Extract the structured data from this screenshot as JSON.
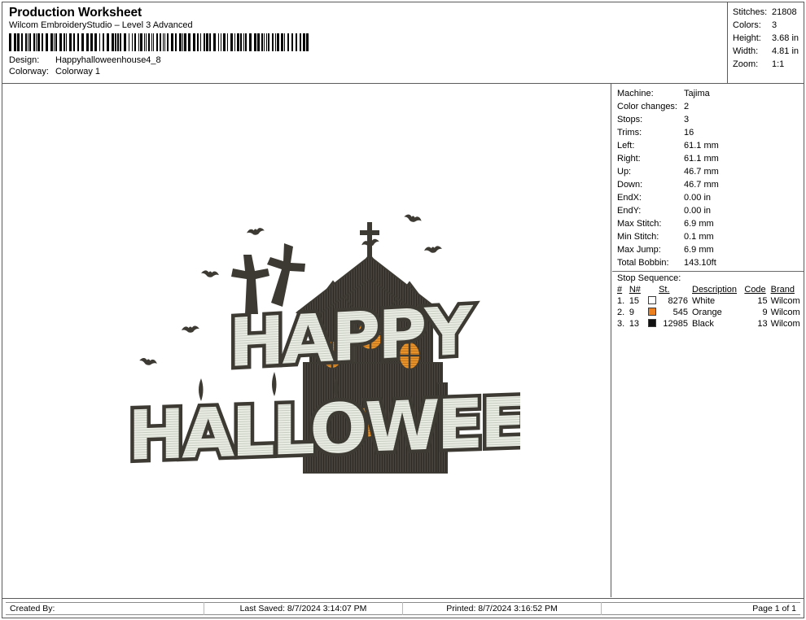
{
  "header": {
    "doc_title": "Production Worksheet",
    "app_name": "Wilcom EmbroideryStudio – Level 3 Advanced",
    "barcode_icon": "barcode",
    "design_label": "Design:",
    "design_value": "Happyhalloweenhouse4_8",
    "colorway_label": "Colorway:",
    "colorway_value": "Colorway 1"
  },
  "summary": [
    {
      "label": "Stitches:",
      "value": "21808"
    },
    {
      "label": "Colors:",
      "value": "3"
    },
    {
      "label": "Height:",
      "value": "3.68 in"
    },
    {
      "label": "Width:",
      "value": "4.81 in"
    },
    {
      "label": "Zoom:",
      "value": "1:1"
    }
  ],
  "info": [
    {
      "label": "Machine:",
      "value": "Tajima"
    },
    {
      "label": "Color changes:",
      "value": "2"
    },
    {
      "label": "Stops:",
      "value": "3"
    },
    {
      "label": "Trims:",
      "value": "16"
    },
    {
      "label": "Left:",
      "value": "61.1 mm"
    },
    {
      "label": "Right:",
      "value": "61.1 mm"
    },
    {
      "label": "Up:",
      "value": "46.7 mm"
    },
    {
      "label": "Down:",
      "value": "46.7 mm"
    },
    {
      "label": "EndX:",
      "value": "0.00 in"
    },
    {
      "label": "EndY:",
      "value": "0.00 in"
    },
    {
      "label": "Max Stitch:",
      "value": "6.9 mm"
    },
    {
      "label": "Min Stitch:",
      "value": "0.1 mm"
    },
    {
      "label": "Max Jump:",
      "value": "6.9 mm"
    },
    {
      "label": "Total Bobbin:",
      "value": "143.10ft"
    }
  ],
  "stop_sequence": {
    "title": "Stop Sequence:",
    "columns": [
      "#",
      "N#",
      "",
      "St.",
      "Description",
      "Code",
      "Brand"
    ],
    "rows": [
      {
        "num": "1.",
        "needle": "15",
        "color": "#ffffff",
        "stitches": "8276",
        "description": "White",
        "code": "15",
        "brand": "Wilcom"
      },
      {
        "num": "2.",
        "needle": "9",
        "color": "#ec7f1e",
        "stitches": "545",
        "description": "Orange",
        "code": "9",
        "brand": "Wilcom"
      },
      {
        "num": "3.",
        "needle": "13",
        "color": "#111111",
        "stitches": "12985",
        "description": "Black",
        "code": "13",
        "brand": "Wilcom"
      }
    ]
  },
  "footer": {
    "created_by": "Created By:",
    "last_saved": "Last Saved: 8/7/2024 3:14:07 PM",
    "printed": "Printed: 8/7/2024 3:16:52 PM",
    "page": "Page 1 of 1"
  },
  "design": {
    "name": "halloween-haunted-house-embroidery",
    "text_line_1": "HAPPY",
    "text_line_2": "HALLOWEEN",
    "colors": {
      "thread_white": "#e9ece3",
      "thread_outline": "#3d3a33",
      "thread_house": "#45403a",
      "thread_orange": "#e8922a",
      "thread_black": "#332f2a"
    },
    "elements": [
      "bats",
      "crosses",
      "haunted-house",
      "lettering"
    ]
  }
}
